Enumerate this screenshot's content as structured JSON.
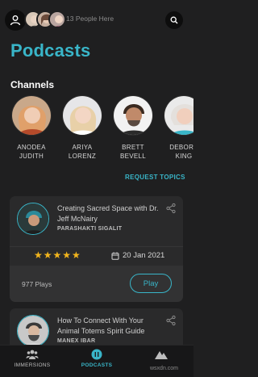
{
  "colors": {
    "accent": "#39b5c8",
    "background": "#1f1f20",
    "card": "#2a2a2b",
    "star": "#f2b51d"
  },
  "header": {
    "profile_icon": "user-icon",
    "people_count": "13 People Here",
    "search_icon": "search-icon"
  },
  "page": {
    "title": "Podcasts",
    "channels_heading": "Channels"
  },
  "channels": [
    {
      "name": "ANODEA\nJUDITH"
    },
    {
      "name": "ARIYA\nLORENZ"
    },
    {
      "name": "BRETT\nBEVELL"
    },
    {
      "name": "DEBORA\nKING"
    }
  ],
  "request_topics": "REQUEST TOPICS",
  "podcasts": [
    {
      "title": "Creating Sacred Space with Dr. Jeff McNairy",
      "author": "PARASHAKTI SIGALIT",
      "rating": 5,
      "stars": "★★★★★",
      "date": "20 Jan 2021",
      "plays": "977 Plays",
      "play_label": "Play"
    },
    {
      "title": "How To Connect With Your Animal Totems Spirit Guide",
      "author": "MANEX IBAR"
    }
  ],
  "nav": {
    "items": [
      {
        "label": "IMMERSIONS",
        "icon": "people-icon"
      },
      {
        "label": "PODCASTS",
        "icon": "podcast-icon",
        "active": true
      },
      {
        "label": "",
        "icon": "mountain-icon"
      }
    ]
  },
  "watermark": "wsxdn.com"
}
